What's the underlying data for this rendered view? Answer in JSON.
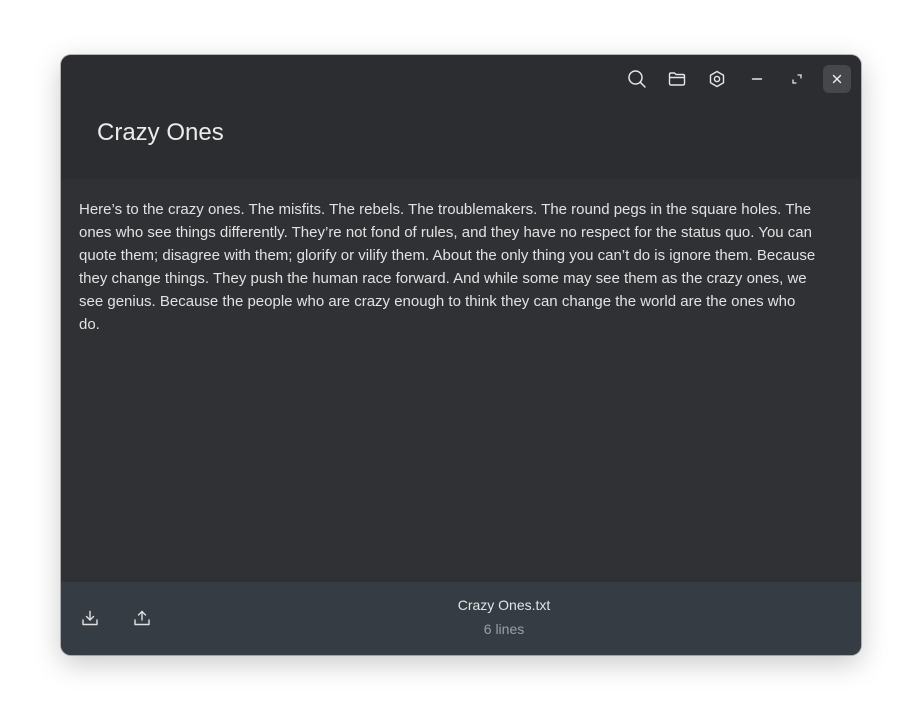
{
  "window": {
    "title_buttons": [
      {
        "name": "search-icon"
      },
      {
        "name": "folder-icon"
      },
      {
        "name": "settings-icon"
      },
      {
        "name": "minimize-icon"
      },
      {
        "name": "maximize-icon"
      },
      {
        "name": "close-icon"
      }
    ]
  },
  "document": {
    "title": "Crazy Ones",
    "body": "Here’s to the crazy ones. The misfits. The rebels. The troublemakers. The round pegs in the square holes. The ones who see things differently. They’re not fond of rules, and they have no respect for the status quo. You can quote them; disagree with them; glorify or vilify them. About the only thing you can’t do is ignore them. Because they change things. They push the human race forward. And while some may see them as the crazy ones, we see genius. Because the people who are crazy enough to think they can change the world are the ones who do."
  },
  "footer": {
    "file_name": "Crazy Ones.txt",
    "line_count": "6 lines",
    "buttons": [
      {
        "name": "import-icon"
      },
      {
        "name": "export-icon"
      }
    ]
  },
  "colors": {
    "window_bg": "#303134",
    "header_bg": "#2c2d30",
    "footer_bg": "#363c44",
    "text": "#e2e2e2",
    "muted_text": "#9aa0a8"
  }
}
